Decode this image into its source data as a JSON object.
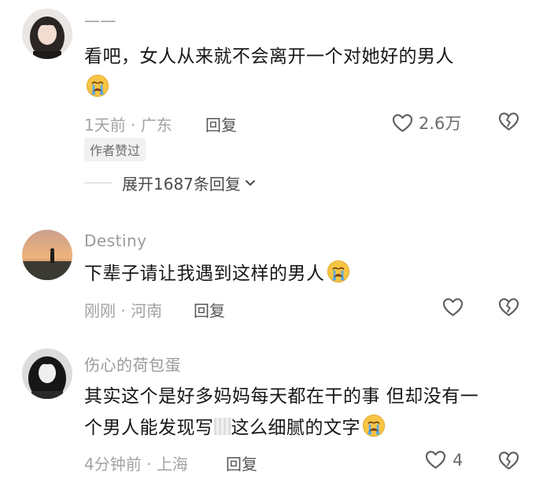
{
  "comments": [
    {
      "username": "——",
      "text": "看吧，女人从来就不会离开一个对她好的男人",
      "emoji": "loudly-crying-face-emoji",
      "time": "1天前",
      "location": "广东",
      "reply_label": "回复",
      "like_count": "2.6万",
      "author_badge": "作者赞过",
      "expand_label": "展开1687条回复"
    },
    {
      "username": "Destiny",
      "text": "下辈子请让我遇到这样的男人",
      "emoji": "loudly-crying-face-emoji",
      "time": "刚刚",
      "location": "河南",
      "reply_label": "回复",
      "like_count": ""
    },
    {
      "username": "伤心的荷包蛋",
      "text_line1": "其实这个是好多妈妈每天都在干的事 但却没有一",
      "text_line2_a": "个男人能发现写",
      "text_line2_b": "这么细腻的文字",
      "emoji": "loudly-crying-face-emoji",
      "time": "4分钟前",
      "location": "上海",
      "reply_label": "回复",
      "like_count": "4"
    }
  ],
  "separator": " · ",
  "colors": {
    "meta_text": "#a3a3a3",
    "body_text": "#161616",
    "icon_stroke": "#5f5f5f",
    "emoji_face": "#f7c544",
    "emoji_tears": "#5aa8e8"
  }
}
